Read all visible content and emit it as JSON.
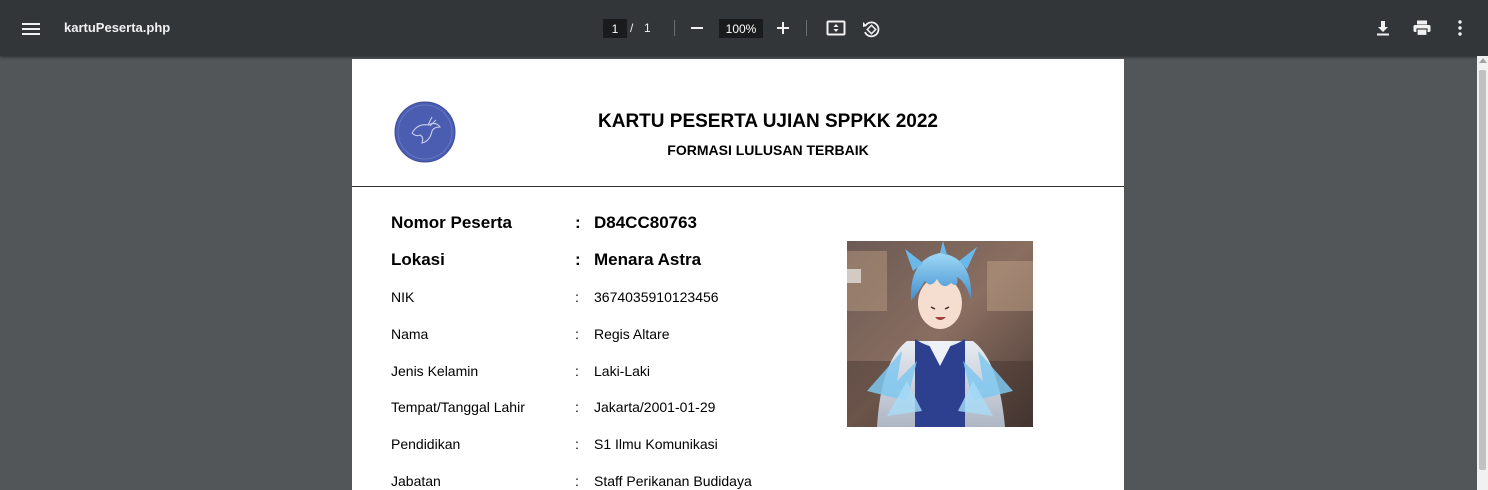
{
  "viewer": {
    "file_name": "kartuPeserta.php",
    "current_page": "1",
    "page_separator": "/",
    "total_pages": "1",
    "zoom": "100%"
  },
  "card": {
    "title": "KARTU PESERTA UJIAN SPPKK 2022",
    "subtitle": "FORMASI LULUSAN TERBAIK",
    "separator": ":",
    "fields": [
      {
        "label": "Nomor Peserta",
        "value": "D84CC80763"
      },
      {
        "label": "Lokasi",
        "value": "Menara Astra"
      },
      {
        "label": "NIK",
        "value": "3674035910123456"
      },
      {
        "label": "Nama",
        "value": "Regis Altare"
      },
      {
        "label": "Jenis Kelamin",
        "value": "Laki-Laki"
      },
      {
        "label": "Tempat/Tanggal Lahir",
        "value": "Jakarta/2001-01-29"
      },
      {
        "label": "Pendidikan",
        "value": "S1 Ilmu Komunikasi"
      },
      {
        "label": "Jabatan",
        "value": "Staff Perikanan Budidaya"
      }
    ]
  },
  "colors": {
    "toolbar": "#323639",
    "viewer_bg": "#525659",
    "logo_blue": "#4a5db0"
  }
}
